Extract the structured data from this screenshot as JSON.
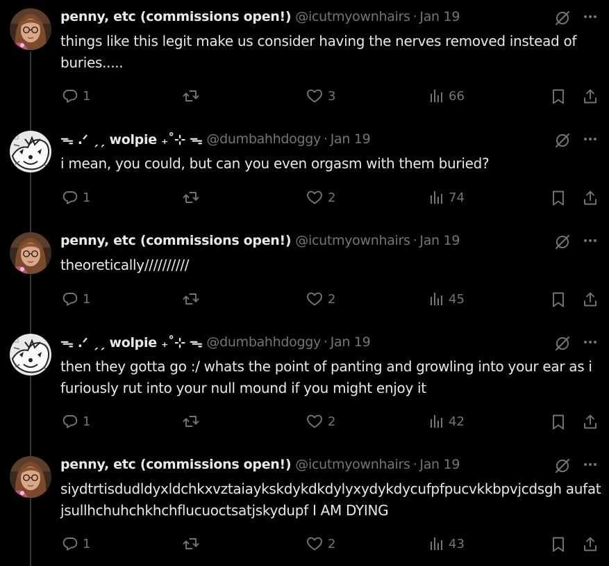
{
  "tweets": [
    {
      "name": "penny, etc (commissions open!)",
      "handle": "@icutmyownhairs",
      "date": "Jan 19",
      "text": "things like this legit make us consider having the nerves removed instead of buries.....",
      "replies": "1",
      "reposts": "",
      "likes": "3",
      "views": "66",
      "avatar": "penny-avatar"
    },
    {
      "name": "ᯓ .ᐟ ˏˏ wolpie ₊˚⊹ ᯓ",
      "handle": "@dumbahhdoggy",
      "date": "Jan 19",
      "text": "i mean, you could, but can you even orgasm with them buried?",
      "replies": "1",
      "reposts": "",
      "likes": "2",
      "views": "74",
      "avatar": "wolpie-avatar"
    },
    {
      "name": "penny, etc (commissions open!)",
      "handle": "@icutmyownhairs",
      "date": "Jan 19",
      "text": "theoretically//////////",
      "replies": "1",
      "reposts": "",
      "likes": "2",
      "views": "45",
      "avatar": "penny-avatar"
    },
    {
      "name": "ᯓ .ᐟ ˏˏ wolpie ₊˚⊹ ᯓ",
      "handle": "@dumbahhdoggy",
      "date": "Jan 19",
      "text": "then they gotta go :/ whats the point of panting and growling into your ear as i furiously rut into your null mound if you might enjoy it",
      "replies": "1",
      "reposts": "",
      "likes": "2",
      "views": "42",
      "avatar": "wolpie-avatar"
    },
    {
      "name": "penny, etc (commissions open!)",
      "handle": "@icutmyownhairs",
      "date": "Jan 19",
      "text": "siydtrtisdudldyxldchkxvztaiaykskdykdkdylyxydykdycufpfpucvkkbpvjcdsgh aufatjsullhchuhchkhchflucuoctsatjskydupf I AM DYING",
      "replies": "1",
      "reposts": "",
      "likes": "2",
      "views": "43",
      "avatar": "penny-avatar"
    }
  ],
  "colors": {
    "background": "#000000",
    "text": "#e7e9ea",
    "muted": "#71767b",
    "thread_line": "#333639"
  }
}
